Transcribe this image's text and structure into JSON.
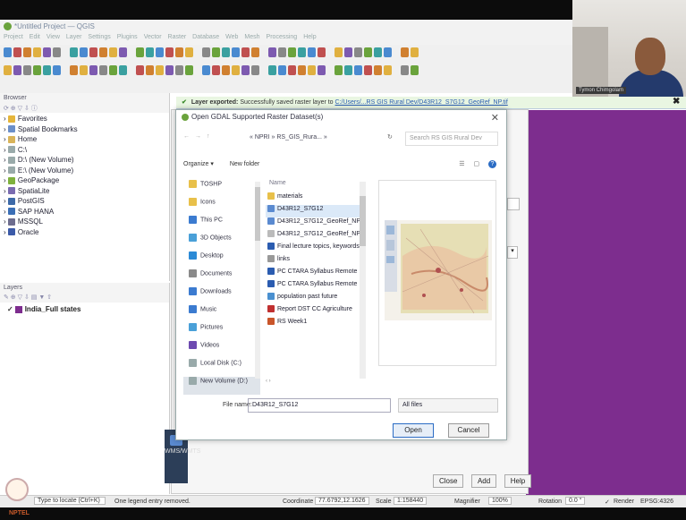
{
  "window": {
    "title": "*Untitled Project — QGIS",
    "menu": [
      "Project",
      "Edit",
      "View",
      "Layer",
      "Settings",
      "Plugins",
      "Vector",
      "Raster",
      "Database",
      "Web",
      "Mesh",
      "Processing",
      "Help"
    ]
  },
  "webcam": {
    "name_tag": "Tymon Chimgolam"
  },
  "browser": {
    "title": "Browser",
    "items": [
      {
        "label": "Favorites",
        "icon": "star-icon",
        "color": "#e5b53a"
      },
      {
        "label": "Spatial Bookmarks",
        "icon": "bookmark-icon",
        "color": "#6b8fc9"
      },
      {
        "label": "Home",
        "icon": "home-folder-icon",
        "color": "#d9b45a"
      },
      {
        "label": "C:\\",
        "icon": "drive-icon",
        "color": "#9aa"
      },
      {
        "label": "D:\\ (New Volume)",
        "icon": "drive-icon",
        "color": "#9aa"
      },
      {
        "label": "E:\\ (New Volume)",
        "icon": "drive-icon",
        "color": "#9aa"
      },
      {
        "label": "GeoPackage",
        "icon": "geopackage-icon",
        "color": "#7fb13d"
      },
      {
        "label": "SpatiaLite",
        "icon": "spatialite-icon",
        "color": "#7a6bb0"
      },
      {
        "label": "PostGIS",
        "icon": "postgis-icon",
        "color": "#3d6aa8"
      },
      {
        "label": "SAP HANA",
        "icon": "sap-hana-icon",
        "color": "#3b6fb6"
      },
      {
        "label": "MSSQL",
        "icon": "mssql-icon",
        "color": "#6d6d8e"
      },
      {
        "label": "Oracle",
        "icon": "oracle-icon",
        "color": "#3b5aa8"
      }
    ]
  },
  "layers": {
    "title": "Layers",
    "items": [
      {
        "label": "India_Full states",
        "color": "#7d2d8e"
      }
    ]
  },
  "message_bar": {
    "prefix": "Layer exported:",
    "text": "Successfully saved raster layer to",
    "link": "C:/Users/...RS GIS Rural Dev/D43R12_S7G12_GeoRef_NP.tif"
  },
  "dialog": {
    "title": "Open GDAL Supported Raster Dataset(s)",
    "path": "« NPRI » RS_GIS_Rura... »",
    "search_placeholder": "Search RS GIS Rural Dev",
    "organize": "Organize ▾",
    "new_folder": "New folder",
    "nav_items": [
      {
        "label": "TOSHP",
        "icon": "folder-icon",
        "color": "#e8c04a"
      },
      {
        "label": "Icons",
        "icon": "folder-icon",
        "color": "#e8c04a"
      },
      {
        "label": "This PC",
        "icon": "pc-icon",
        "color": "#3b7bd0"
      },
      {
        "label": "3D Objects",
        "icon": "3d-objects-icon",
        "color": "#4aa0d8"
      },
      {
        "label": "Desktop",
        "icon": "desktop-icon",
        "color": "#2b8ad6"
      },
      {
        "label": "Documents",
        "icon": "documents-icon",
        "color": "#8a8a8a"
      },
      {
        "label": "Downloads",
        "icon": "downloads-icon",
        "color": "#3b7bd0"
      },
      {
        "label": "Music",
        "icon": "music-icon",
        "color": "#3b7bd0"
      },
      {
        "label": "Pictures",
        "icon": "pictures-icon",
        "color": "#4aa0d8"
      },
      {
        "label": "Videos",
        "icon": "videos-icon",
        "color": "#6d4ab0"
      },
      {
        "label": "Local Disk (C:)",
        "icon": "disk-icon",
        "color": "#9aa"
      },
      {
        "label": "New Volume (D:)",
        "icon": "disk-icon",
        "color": "#9aa"
      }
    ],
    "file_header": "Name",
    "files": [
      {
        "label": "materials",
        "icon": "folder-icon",
        "color": "#e8c04a"
      },
      {
        "label": "D43R12_S7G12",
        "icon": "raster-icon",
        "color": "#5a8ad0"
      },
      {
        "label": "D43R12_S7G12_GeoRef_NP",
        "icon": "raster-icon",
        "color": "#5a8ad0"
      },
      {
        "label": "D43R12_S7G12_GeoRef_NP",
        "icon": "file-icon",
        "color": "#bbb"
      },
      {
        "label": "Final lecture topics, keywords",
        "icon": "word-icon",
        "color": "#2b5cb0"
      },
      {
        "label": "links",
        "icon": "text-file-icon",
        "color": "#999"
      },
      {
        "label": "PC CTARA Syllabus Remote",
        "icon": "word-icon",
        "color": "#2b5cb0"
      },
      {
        "label": "PC CTARA Syllabus Remote",
        "icon": "word-icon",
        "color": "#2b5cb0"
      },
      {
        "label": "population past future",
        "icon": "image-icon",
        "color": "#4a90d0"
      },
      {
        "label": "Report DST CC Agriculture",
        "icon": "pdf-icon",
        "color": "#c03030"
      },
      {
        "label": "RS Week1",
        "icon": "ppt-icon",
        "color": "#c9552a"
      }
    ],
    "filename_label": "File name:",
    "filename_value": "D43R12_S7G12",
    "filetype_value": "All files",
    "open_label": "Open",
    "cancel_label": "Cancel"
  },
  "background_dialog": {
    "side_labels": [
      "WMS/WMTS"
    ],
    "close_label": "Close",
    "add_label": "Add",
    "help_label": "Help"
  },
  "status_bar": {
    "locate_placeholder": "Type to locate (Ctrl+K)",
    "message": "One legend entry removed.",
    "coordinate_label": "Coordinate",
    "coordinate_value": "77.6792,12.1626",
    "scale_label": "Scale",
    "scale_value": "1:158440",
    "magnifier_label": "Magnifier",
    "magnifier_value": "100%",
    "rotation_label": "Rotation",
    "rotation_value": "0.0 °",
    "render_label": "Render",
    "crs_value": "EPSG:4326"
  },
  "footer": {
    "brand": "NPTEL"
  }
}
